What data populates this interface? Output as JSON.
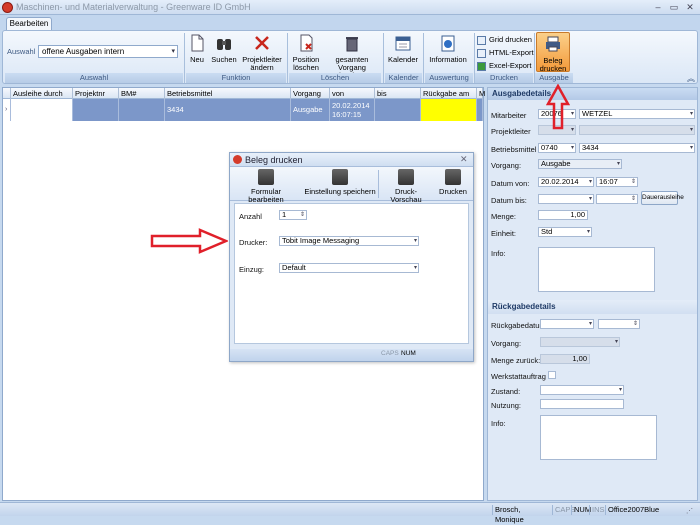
{
  "window": {
    "title": "Maschinen- und Materialverwaltung - Greenware ID GmbH"
  },
  "tabs": [
    "Bearbeiten"
  ],
  "ribbon": {
    "auswahl": {
      "label": "Auswahl",
      "value": "offene Ausgaben intern",
      "caption": "Auswahl"
    },
    "funktion": {
      "caption": "Funktion",
      "neu": "Neu",
      "suchen": "Suchen",
      "projektleiter": "Projektleiter ändern"
    },
    "loeschen": {
      "caption": "Löschen",
      "position": "Position löschen",
      "vorgang": "gesamten Vorgang löschen"
    },
    "kalender": {
      "caption": "Kalender",
      "label": "Kalender"
    },
    "auswertung": {
      "caption": "Auswertung",
      "label": "Information"
    },
    "drucken": {
      "caption": "Drucken",
      "grid": "Grid drucken",
      "html": "HTML-Export",
      "excel": "Excel-Export"
    },
    "ausgabe": {
      "caption": "Ausgabe",
      "beleg": "Beleg drucken"
    }
  },
  "grid": {
    "columns": [
      "Ausleihe durch",
      "Projektnr",
      "BM#",
      "Betriebsmittel",
      "Vorgang",
      "von",
      "bis",
      "Rückgabe am",
      "M"
    ],
    "row": {
      "betriebsmittel": "3434",
      "vorgang": "Ausgabe",
      "von_date": "20.02.2014",
      "von_time": "16:07:15"
    }
  },
  "ausgabedetails": {
    "title": "Ausgabedetails",
    "mitarbeiter_label": "Mitarbeiter",
    "mitarbeiter_id": "20076",
    "mitarbeiter_name": "WETZEL",
    "projektleiter_label": "Projektleiter",
    "betriebsmittel_label": "Betriebsmittel",
    "bm_nr": "0740",
    "bm_name": "3434",
    "vorgang_label": "Vorgang:",
    "vorgang": "Ausgabe",
    "datum_von_label": "Datum von:",
    "datum_von": "20.02.2014",
    "zeit_von": "16:07",
    "datum_bis_label": "Datum bis:",
    "dauer_btn": "Dauerausleihe",
    "menge_label": "Menge:",
    "menge": "1,00",
    "einheit_label": "Einheit:",
    "einheit": "Std",
    "info_label": "Info:"
  },
  "rueckgabedetails": {
    "title": "Rückgabedetails",
    "datum_label": "Rückgabedatum:",
    "vorgang_label": "Vorgang:",
    "menge_label": "Menge zurück:",
    "menge": "1,00",
    "werkstatt_label": "Werkstattauftrag",
    "zustand_label": "Zustand:",
    "nutzung_label": "Nutzung:",
    "info_label": "Info:"
  },
  "dialog": {
    "title": "Beleg drucken",
    "tools": [
      "Formular bearbeiten",
      "Einstellung speichern",
      "Druck-Vorschau",
      "Drucken"
    ],
    "anzahl_label": "Anzahl",
    "anzahl": "1",
    "drucker_label": "Drucker:",
    "drucker": "Tobit Image Messaging",
    "einzug_label": "Einzug:",
    "einzug": "Default",
    "status": [
      "CAPS",
      "NUM"
    ]
  },
  "statusbar": {
    "user": "Brosch, Monique",
    "caps": "CAPS",
    "num": "NUM",
    "ins": "INS",
    "theme": "Office2007Blue"
  },
  "colors": {
    "selected_row": "#7c97c9",
    "rueckgabe_highlight": "#ffff00",
    "arrow": "#e0202a",
    "beleg_active": "#f6a04a"
  }
}
